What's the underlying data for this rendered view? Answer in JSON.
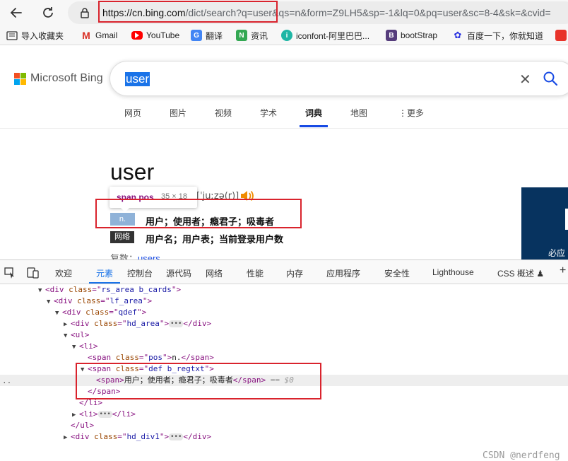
{
  "browser": {
    "url_host": "https://cn.bing.com",
    "url_rest": "/dict/search?q=user&qs=n&form=Z9LH5&sp=-1&lq=0&pq=user&sc=8-4&sk=&cvid=",
    "bookmarks": [
      {
        "label": "导入收藏夹",
        "icon": "folder-icon"
      },
      {
        "label": "Gmail",
        "icon": "gmail-icon",
        "color": "#d93025"
      },
      {
        "label": "YouTube",
        "icon": "youtube-icon",
        "color": "#ff0000"
      },
      {
        "label": "翻译",
        "icon": "translate-icon",
        "color": "#4285f4"
      },
      {
        "label": "资讯",
        "icon": "news-icon",
        "color": "#34a853"
      },
      {
        "label": "iconfont-阿里巴巴...",
        "icon": "iconfont-icon",
        "color": "#1fb6a5"
      },
      {
        "label": "bootStrap",
        "icon": "bootstrap-icon",
        "color": "#563d7c"
      },
      {
        "label": "百度一下，你就知道",
        "icon": "baidu-icon",
        "color": "#2932e1"
      }
    ]
  },
  "bing": {
    "logo_text": "Microsoft Bing",
    "query": "user",
    "tabs": [
      "网页",
      "图片",
      "视频",
      "学术",
      "词典",
      "地图",
      "更多"
    ],
    "active_tab": "词典",
    "word": "user",
    "tooltip_selector": "span.pos",
    "tooltip_size": "35 × 18",
    "phonetic": "[ˈjuːzə(r)]",
    "pos": "n.",
    "definition": "用户；使用者；瘾君子；吸毒者",
    "web_tag": "网络",
    "web_definition": "用户名；用户表；当前登录用户数",
    "plural_label": "复数：",
    "plural_value": "users",
    "side_caption": "必应"
  },
  "devtools": {
    "tabs": [
      "欢迎",
      "元素",
      "控制台",
      "源代码",
      "网络",
      "性能",
      "内存",
      "应用程序",
      "安全性",
      "Lighthouse",
      "CSS 概述"
    ],
    "active_tab": "元素",
    "dom": {
      "l1": {
        "tag": "div",
        "attr": "class",
        "val": "rs_area b_cards"
      },
      "l2": {
        "tag": "div",
        "attr": "class",
        "val": "lf_area"
      },
      "l3": {
        "tag": "div",
        "attr": "class",
        "val": "qdef"
      },
      "l4": {
        "tag": "div",
        "attr": "class",
        "val": "hd_area"
      },
      "l5": {
        "tag": "ul"
      },
      "l6": {
        "tag": "li"
      },
      "l7": {
        "tag": "span",
        "attr": "class",
        "val": "pos",
        "text": "n."
      },
      "l8": {
        "tag": "span",
        "attr": "class",
        "val": "def b_regtxt"
      },
      "l9": {
        "tag": "span",
        "text": "用户；使用者；瘾君子；吸毒者",
        "eq": "== $0"
      },
      "l10": {
        "tag": "span"
      },
      "l11": {
        "tag": "li"
      },
      "l12": {
        "tag": "li"
      },
      "l13": {
        "tag": "ul"
      },
      "l14": {
        "tag": "div",
        "attr": "class",
        "val": "hd_div1"
      }
    },
    "watermark": "CSDN @nerdfeng"
  },
  "colors": {
    "highlight_red": "#d9232d",
    "bing_blue": "#174ae4",
    "dt_blue": "#1a73e8",
    "pos_blue": "#8fb2d8",
    "tag_purple": "#881280",
    "attr_brown": "#994500",
    "val_blue": "#1a1aa6"
  }
}
